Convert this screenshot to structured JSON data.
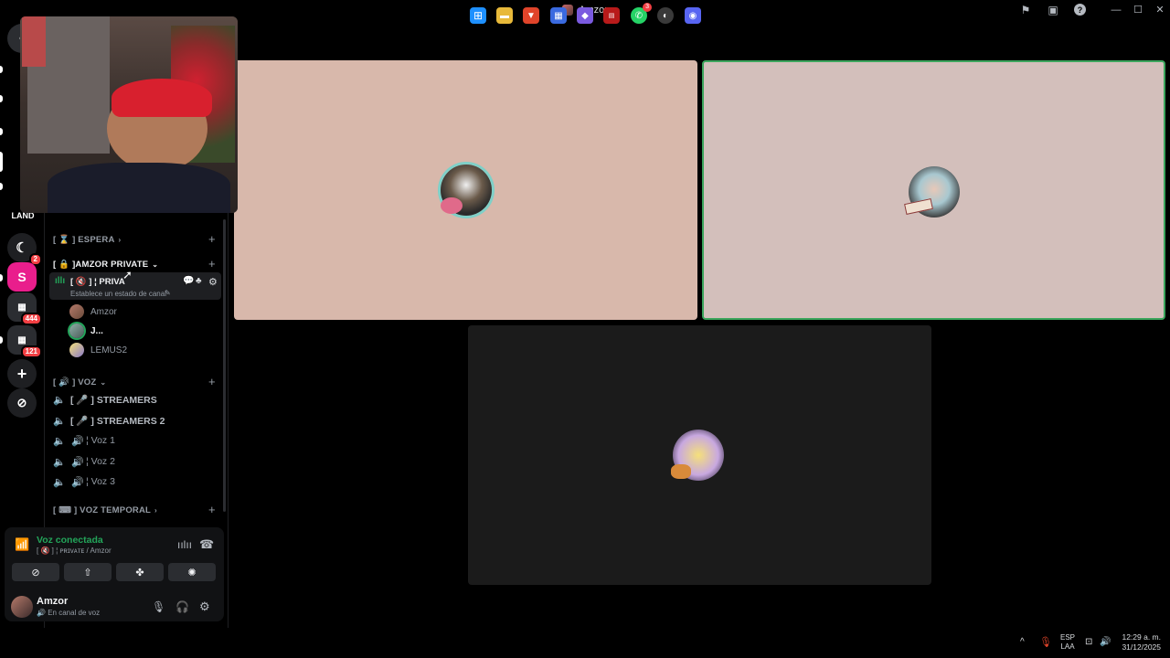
{
  "window": {
    "title": "Amzor"
  },
  "servers": {
    "badge_1": "2",
    "s_letter": "S",
    "badge_444": "444",
    "badge_121": "121",
    "land_text": "LAND"
  },
  "sidebar": {
    "categories": {
      "espera": "[ ⌛ ] ESPERA",
      "amzor_private": "[ 🔒 ]AMZOR PRIVATE",
      "voz": "[ 🔊 ] VOZ",
      "voz_temporal": "[ ⌨ ] VOZ TEMPORAL"
    },
    "active_channel": {
      "name": "[ 🔇 ] ¦ PRIVA",
      "status": "Establece un estado de canal"
    },
    "voice_users": [
      "Amzor",
      "J...",
      "LEMUS2"
    ],
    "channels": [
      "[ 🎤 ] STREAMERS",
      "[ 🎤 ] STREAMERS 2",
      "¦ Voz 1",
      "¦ Voz 2",
      "¦ Voz 3"
    ]
  },
  "voice_panel": {
    "status": "Voz conectada",
    "channel": "[ 🔇 ] ¦ ᴘʀɪᴠᴀᴛᴇ / Amzor"
  },
  "user_panel": {
    "name": "Amzor",
    "status": "En canal de voz"
  },
  "taskbar": {
    "lang_1": "ESP",
    "lang_2": "LAA",
    "time": "12:29 a. m.",
    "date": "31/12/2025",
    "whatsapp_badge": "3"
  },
  "colors": {
    "accent_green": "#23a55a",
    "tile_left": "#d8b8ab",
    "tile_right": "#d3bfbb",
    "tile_bottom": "#1b1b1b",
    "speaking_border": "#3ba55c",
    "brand": "#5865f2"
  }
}
